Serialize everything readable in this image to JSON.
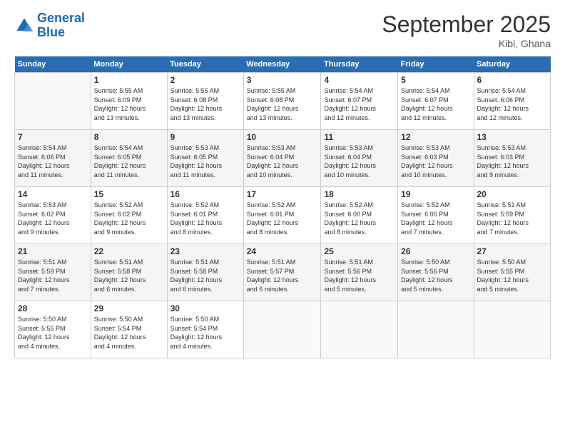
{
  "header": {
    "logo_line1": "General",
    "logo_line2": "Blue",
    "month_title": "September 2025",
    "subtitle": "Kibi, Ghana"
  },
  "days_of_week": [
    "Sunday",
    "Monday",
    "Tuesday",
    "Wednesday",
    "Thursday",
    "Friday",
    "Saturday"
  ],
  "weeks": [
    [
      {
        "day": "",
        "info": ""
      },
      {
        "day": "1",
        "info": "Sunrise: 5:55 AM\nSunset: 6:09 PM\nDaylight: 12 hours\nand 13 minutes."
      },
      {
        "day": "2",
        "info": "Sunrise: 5:55 AM\nSunset: 6:08 PM\nDaylight: 12 hours\nand 13 minutes."
      },
      {
        "day": "3",
        "info": "Sunrise: 5:55 AM\nSunset: 6:08 PM\nDaylight: 12 hours\nand 13 minutes."
      },
      {
        "day": "4",
        "info": "Sunrise: 5:54 AM\nSunset: 6:07 PM\nDaylight: 12 hours\nand 12 minutes."
      },
      {
        "day": "5",
        "info": "Sunrise: 5:54 AM\nSunset: 6:07 PM\nDaylight: 12 hours\nand 12 minutes."
      },
      {
        "day": "6",
        "info": "Sunrise: 5:54 AM\nSunset: 6:06 PM\nDaylight: 12 hours\nand 12 minutes."
      }
    ],
    [
      {
        "day": "7",
        "info": "Sunrise: 5:54 AM\nSunset: 6:06 PM\nDaylight: 12 hours\nand 11 minutes."
      },
      {
        "day": "8",
        "info": "Sunrise: 5:54 AM\nSunset: 6:05 PM\nDaylight: 12 hours\nand 11 minutes."
      },
      {
        "day": "9",
        "info": "Sunrise: 5:53 AM\nSunset: 6:05 PM\nDaylight: 12 hours\nand 11 minutes."
      },
      {
        "day": "10",
        "info": "Sunrise: 5:53 AM\nSunset: 6:04 PM\nDaylight: 12 hours\nand 10 minutes."
      },
      {
        "day": "11",
        "info": "Sunrise: 5:53 AM\nSunset: 6:04 PM\nDaylight: 12 hours\nand 10 minutes."
      },
      {
        "day": "12",
        "info": "Sunrise: 5:53 AM\nSunset: 6:03 PM\nDaylight: 12 hours\nand 10 minutes."
      },
      {
        "day": "13",
        "info": "Sunrise: 5:53 AM\nSunset: 6:03 PM\nDaylight: 12 hours\nand 9 minutes."
      }
    ],
    [
      {
        "day": "14",
        "info": "Sunrise: 5:53 AM\nSunset: 6:02 PM\nDaylight: 12 hours\nand 9 minutes."
      },
      {
        "day": "15",
        "info": "Sunrise: 5:52 AM\nSunset: 6:02 PM\nDaylight: 12 hours\nand 9 minutes."
      },
      {
        "day": "16",
        "info": "Sunrise: 5:52 AM\nSunset: 6:01 PM\nDaylight: 12 hours\nand 8 minutes."
      },
      {
        "day": "17",
        "info": "Sunrise: 5:52 AM\nSunset: 6:01 PM\nDaylight: 12 hours\nand 8 minutes."
      },
      {
        "day": "18",
        "info": "Sunrise: 5:52 AM\nSunset: 6:00 PM\nDaylight: 12 hours\nand 8 minutes."
      },
      {
        "day": "19",
        "info": "Sunrise: 5:52 AM\nSunset: 6:00 PM\nDaylight: 12 hours\nand 7 minutes."
      },
      {
        "day": "20",
        "info": "Sunrise: 5:51 AM\nSunset: 5:59 PM\nDaylight: 12 hours\nand 7 minutes."
      }
    ],
    [
      {
        "day": "21",
        "info": "Sunrise: 5:51 AM\nSunset: 5:59 PM\nDaylight: 12 hours\nand 7 minutes."
      },
      {
        "day": "22",
        "info": "Sunrise: 5:51 AM\nSunset: 5:58 PM\nDaylight: 12 hours\nand 6 minutes."
      },
      {
        "day": "23",
        "info": "Sunrise: 5:51 AM\nSunset: 5:58 PM\nDaylight: 12 hours\nand 6 minutes."
      },
      {
        "day": "24",
        "info": "Sunrise: 5:51 AM\nSunset: 5:57 PM\nDaylight: 12 hours\nand 6 minutes."
      },
      {
        "day": "25",
        "info": "Sunrise: 5:51 AM\nSunset: 5:56 PM\nDaylight: 12 hours\nand 5 minutes."
      },
      {
        "day": "26",
        "info": "Sunrise: 5:50 AM\nSunset: 5:56 PM\nDaylight: 12 hours\nand 5 minutes."
      },
      {
        "day": "27",
        "info": "Sunrise: 5:50 AM\nSunset: 5:55 PM\nDaylight: 12 hours\nand 5 minutes."
      }
    ],
    [
      {
        "day": "28",
        "info": "Sunrise: 5:50 AM\nSunset: 5:55 PM\nDaylight: 12 hours\nand 4 minutes."
      },
      {
        "day": "29",
        "info": "Sunrise: 5:50 AM\nSunset: 5:54 PM\nDaylight: 12 hours\nand 4 minutes."
      },
      {
        "day": "30",
        "info": "Sunrise: 5:50 AM\nSunset: 5:54 PM\nDaylight: 12 hours\nand 4 minutes."
      },
      {
        "day": "",
        "info": ""
      },
      {
        "day": "",
        "info": ""
      },
      {
        "day": "",
        "info": ""
      },
      {
        "day": "",
        "info": ""
      }
    ]
  ]
}
